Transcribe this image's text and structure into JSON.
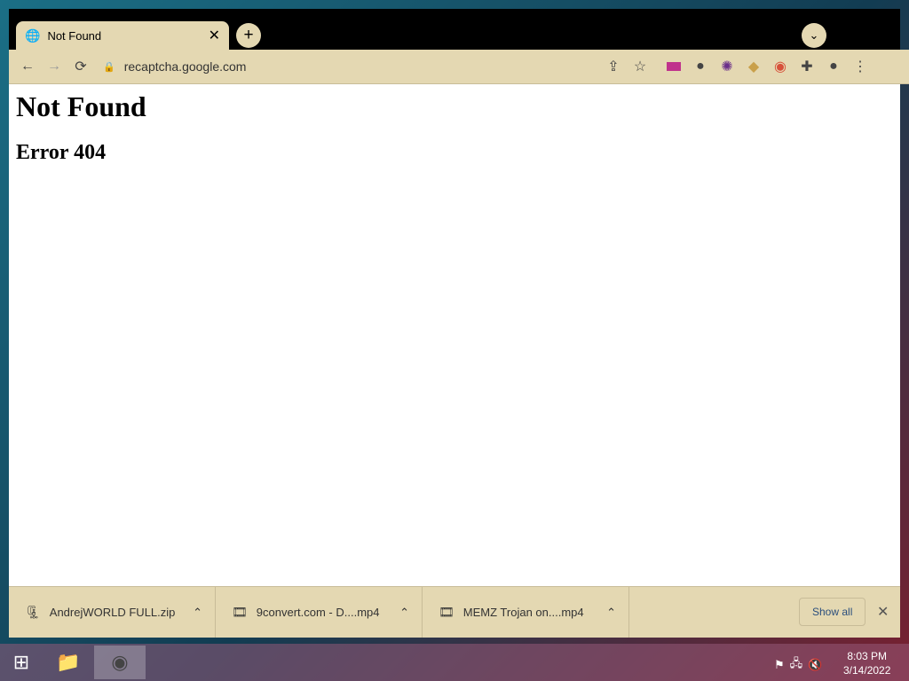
{
  "browser": {
    "tab": {
      "title": "Not Found"
    },
    "url": "recaptcha.google.com"
  },
  "page": {
    "heading": "Not Found",
    "subheading": "Error 404"
  },
  "downloads": {
    "items": [
      {
        "name": "AndrejWORLD FULL.zip"
      },
      {
        "name": "9convert.com - D....mp4"
      },
      {
        "name": "MEMZ Trojan on....mp4"
      }
    ],
    "show_all": "Show all"
  },
  "taskbar": {
    "time": "8:03 PM",
    "date": "3/14/2022"
  },
  "colors": {
    "chrome": "#e4d8b2",
    "tabbar": "#000000"
  }
}
